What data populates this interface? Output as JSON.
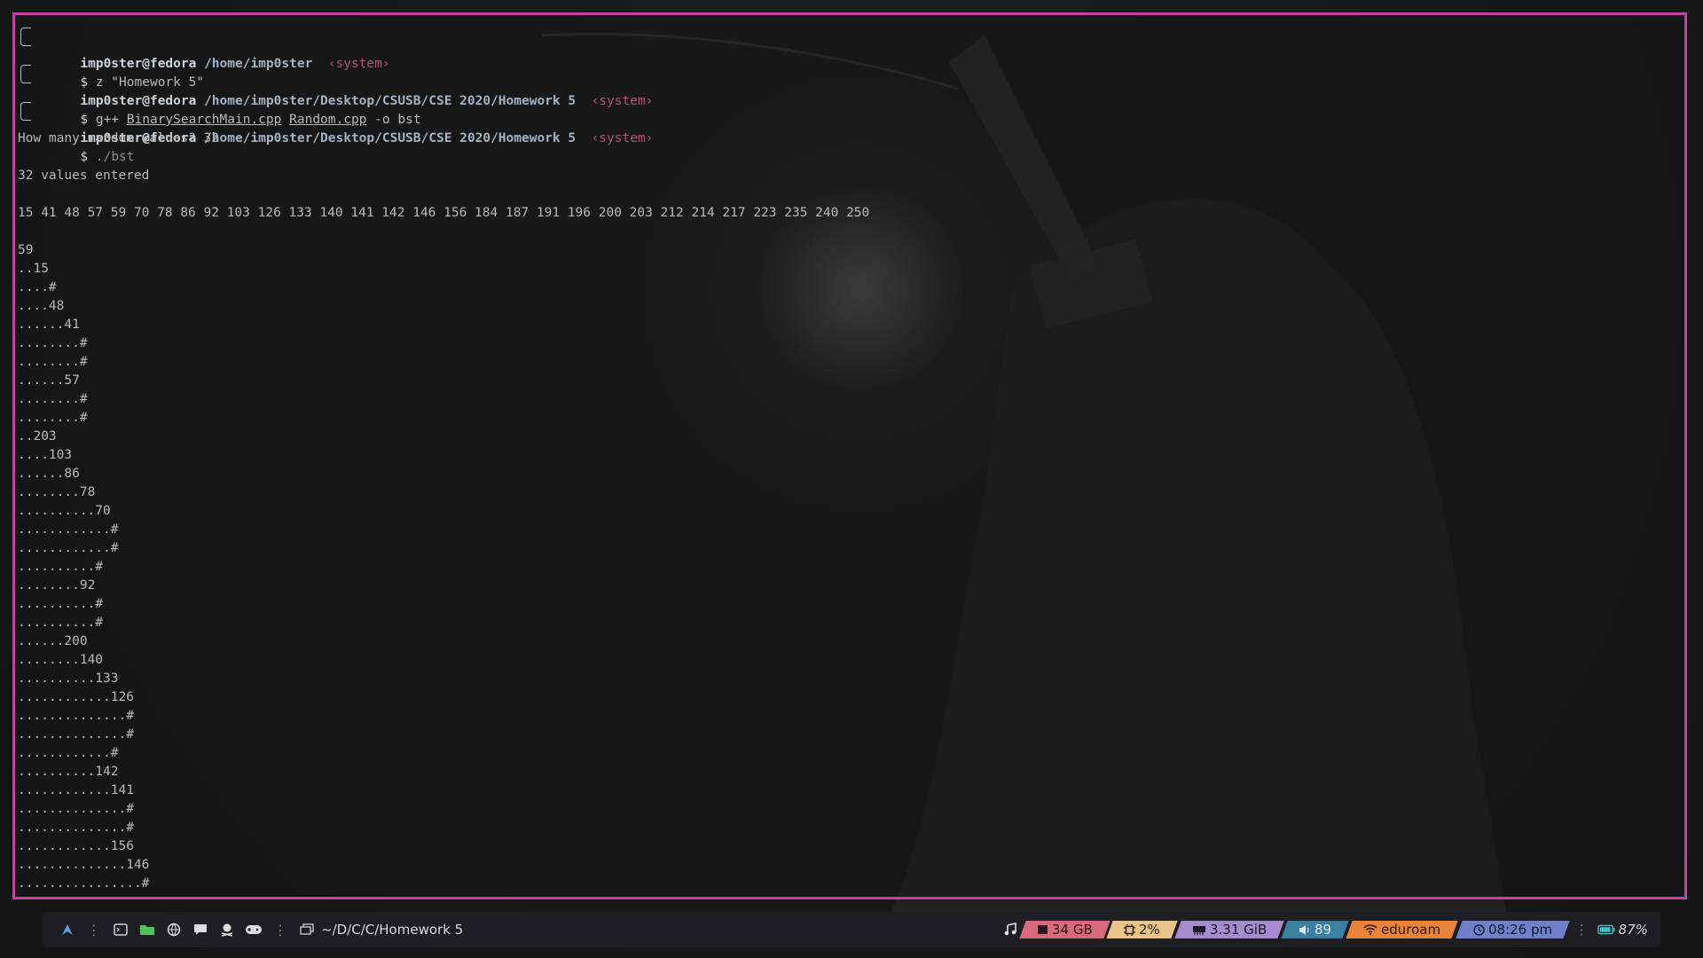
{
  "terminal": {
    "sessions": [
      {
        "user": "imp0ster@fedora",
        "path": "/home/imp0ster",
        "tag": "‹system›",
        "command": "z \"Homework 5\""
      },
      {
        "user": "imp0ster@fedora",
        "path": "/home/imp0ster/Desktop/CSUSB/CSE 2020/Homework 5",
        "tag": "‹system›",
        "cmd_prefix": "g++ ",
        "cmd_file1": "BinarySearchMain.cpp",
        "cmd_space": " ",
        "cmd_file2": "Random.cpp",
        "cmd_suffix": " -o bst"
      },
      {
        "user": "imp0ster@fedora",
        "path": "/home/imp0ster/Desktop/CSUSB/CSE 2020/Homework 5",
        "tag": "‹system›",
        "command": "./bst"
      }
    ],
    "prompt_symbol": "$",
    "output": [
      "How many random values? 32",
      "",
      "32 values entered",
      "",
      "15 41 48 57 59 70 78 86 92 103 126 133 140 141 142 146 156 184 187 191 196 200 203 212 214 217 223 235 240 250",
      "",
      "59",
      "..15",
      "....#",
      "....48",
      "......41",
      "........#",
      "........#",
      "......57",
      "........#",
      "........#",
      "..203",
      "....103",
      "......86",
      "........78",
      "..........70",
      "............#",
      "............#",
      "..........#",
      "........92",
      "..........#",
      "..........#",
      "......200",
      "........140",
      "..........133",
      "............126",
      "..............#",
      "..............#",
      "............#",
      "..........142",
      "............141",
      "..............#",
      "..............#",
      "............156",
      "..............146",
      "................#"
    ]
  },
  "taskbar": {
    "workspace_path": "~/D/C/C/Homework 5",
    "disk": "34 GB",
    "cpu": "2%",
    "memory": "3.31 GiB",
    "volume": "89",
    "network": "eduroam",
    "clock": "08:26 pm",
    "battery": "87%",
    "colors": {
      "disk": "#d9697f",
      "cpu": "#e8c48a",
      "memory": "#a48ccf",
      "volume": "#3a7fa0",
      "network": "#e8833a",
      "clock": "#6f82c9",
      "border": "#c23fb0"
    }
  }
}
